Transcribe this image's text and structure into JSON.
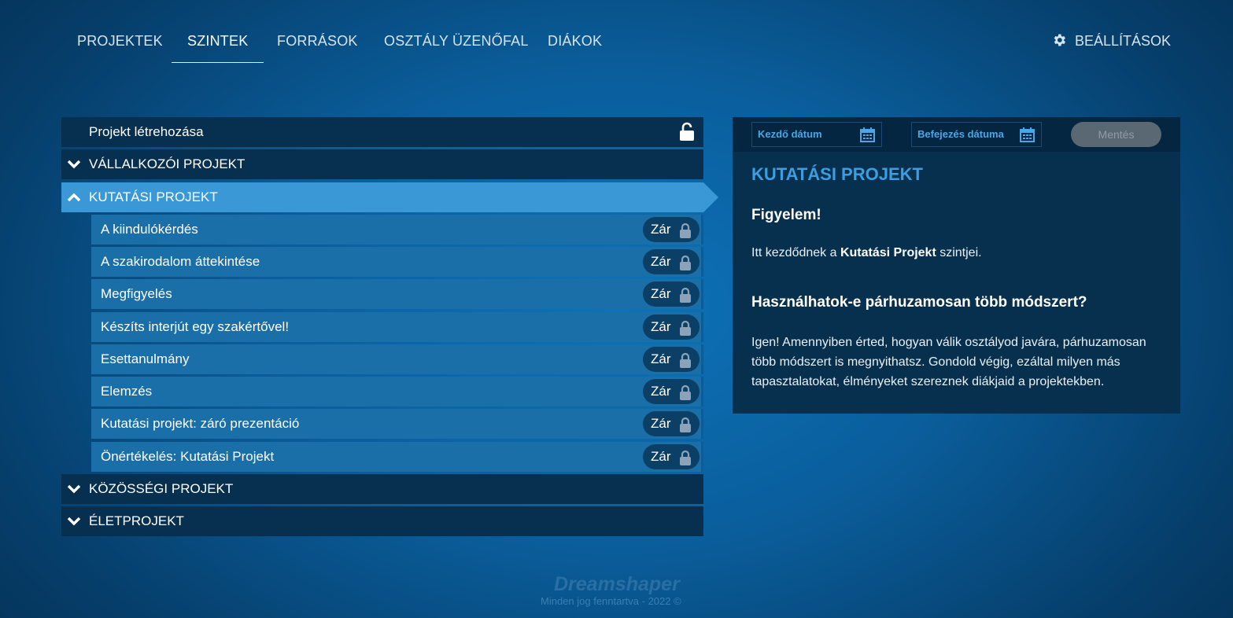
{
  "nav": {
    "tabs": [
      {
        "label": "PROJEKTEK"
      },
      {
        "label": "SZINTEK"
      },
      {
        "label": "FORRÁSOK"
      },
      {
        "label": "OSZTÁLY ÜZENŐFAL"
      },
      {
        "label": "DIÁKOK"
      }
    ],
    "active_tab": "SZINTEK",
    "settings_label": "BEÁLLÍTÁSOK"
  },
  "levels": {
    "create_project": "Projekt létrehozása",
    "groups": {
      "vallalkozoi": "VÁLLALKOZÓI PROJEKT",
      "kutatasi": "KUTATÁSI PROJEKT",
      "kozossegi": "KÖZÖSSÉGI PROJEKT",
      "eletprojekt": "ÉLETPROJEKT"
    },
    "expanded_group": "KUTATÁSI PROJEKT",
    "lock_label": "Zár",
    "items": [
      {
        "label": "A kiindulókérdés"
      },
      {
        "label": "A szakirodalom áttekintése"
      },
      {
        "label": "Megfigyelés"
      },
      {
        "label": "Készíts interjút egy szakértővel!"
      },
      {
        "label": "Esettanulmány"
      },
      {
        "label": "Elemzés"
      },
      {
        "label": "Kutatási projekt: záró prezentáció"
      },
      {
        "label": "Önértékelés: Kutatási Projekt"
      }
    ]
  },
  "panel": {
    "start_date_placeholder": "Kezdő dátum",
    "end_date_placeholder": "Befejezés dátuma",
    "save_label": "Mentés",
    "title": "KUTATÁSI PROJEKT",
    "warning_heading": "Figyelem!",
    "intro_before": "Itt kezdődnek a ",
    "intro_bold": "Kutatási Projekt",
    "intro_after": " szintjei.",
    "question_heading": "Használhatok-e párhuzamosan több módszert?",
    "answer": "Igen! Amennyiben érted, hogyan válik osztályod javára, párhuzamosan több módszert is megnyithatsz. Gondold végig, ezáltal milyen más tapasztalatokat, élményeket szereznek diákjaid a projektekben."
  },
  "footer": {
    "logo_text": "Dreamshaper",
    "copyright": "Minden jog fenntartva - 2022 ©"
  },
  "colors": {
    "accent": "#3a98d6",
    "title_blue": "#3c9ee0",
    "row_dark": "#072f4f",
    "sub_row": "#1b6fa8",
    "lock_pill": "#0b3f66"
  },
  "icons": {
    "settings": "gear-icon",
    "unlock": "unlock-icon",
    "lock": "lock-icon",
    "calendar": "calendar-icon",
    "chevron_down": "chevron-down-icon",
    "chevron_up": "chevron-up-icon"
  }
}
